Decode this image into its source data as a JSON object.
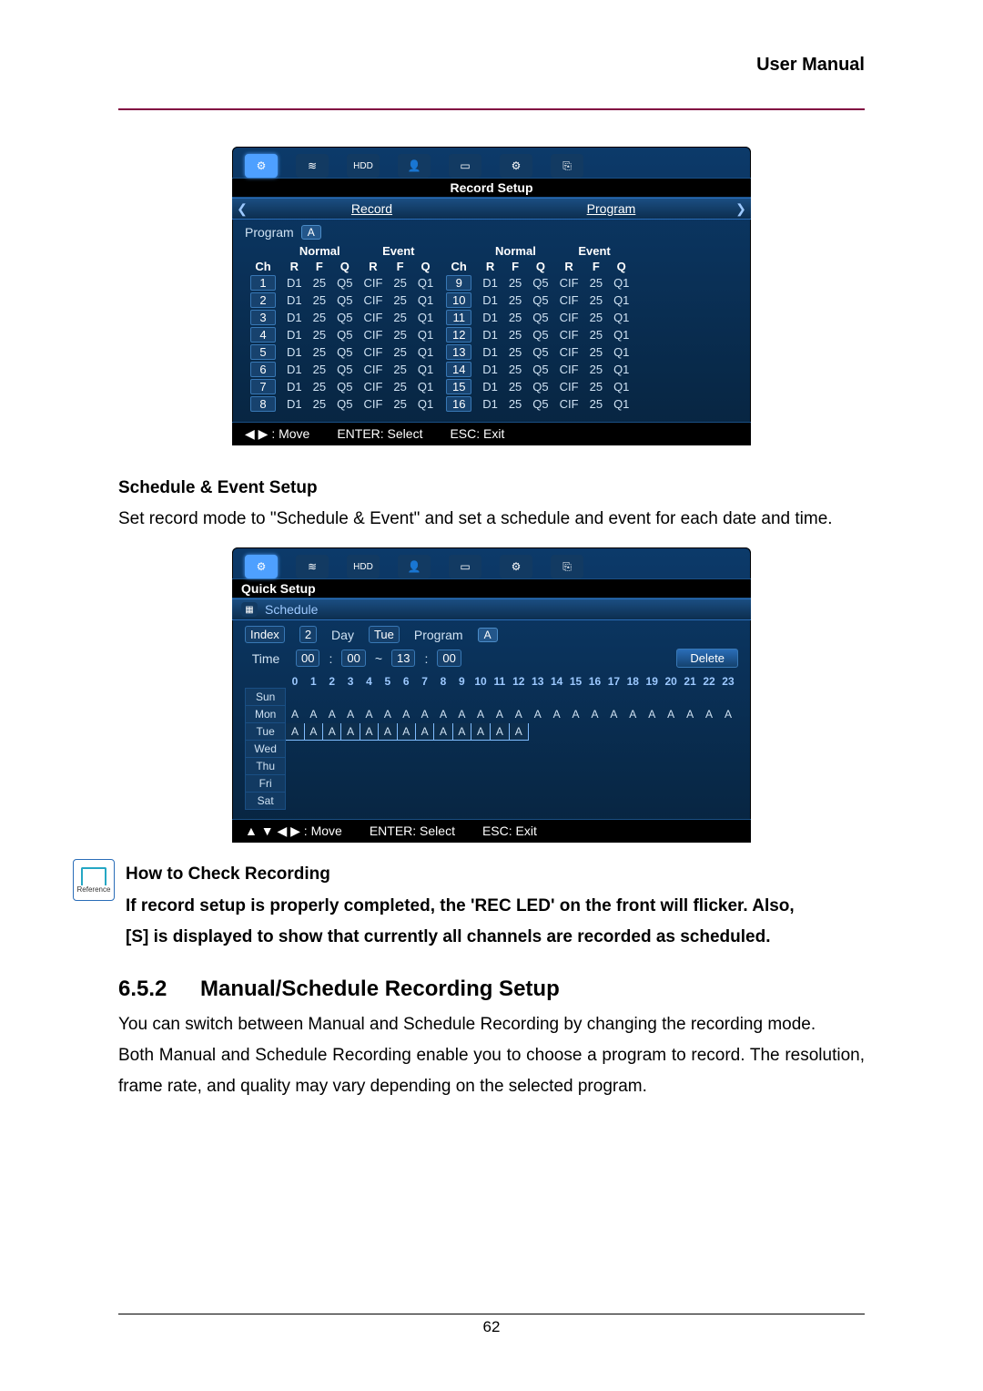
{
  "header": {
    "title": "User Manual"
  },
  "record_panel": {
    "title": "Record Setup",
    "icons": [
      "gear",
      "wifi",
      "hdd",
      "user",
      "display",
      "settings",
      "exit"
    ],
    "tabs": {
      "left": "Record",
      "right": "Program"
    },
    "program_label": "Program",
    "program_badge": "A",
    "group_headers": [
      "Normal",
      "Event",
      "Normal",
      "Event"
    ],
    "col_headers": [
      "Ch",
      "R",
      "F",
      "Q",
      "R",
      "F",
      "Q",
      "Ch",
      "R",
      "F",
      "Q",
      "R",
      "F",
      "Q"
    ],
    "rows_left": [
      {
        "ch": "1",
        "r1": "D1",
        "f1": "25",
        "q1": "Q5",
        "r2": "CIF",
        "f2": "25",
        "q2": "Q1"
      },
      {
        "ch": "2",
        "r1": "D1",
        "f1": "25",
        "q1": "Q5",
        "r2": "CIF",
        "f2": "25",
        "q2": "Q1"
      },
      {
        "ch": "3",
        "r1": "D1",
        "f1": "25",
        "q1": "Q5",
        "r2": "CIF",
        "f2": "25",
        "q2": "Q1"
      },
      {
        "ch": "4",
        "r1": "D1",
        "f1": "25",
        "q1": "Q5",
        "r2": "CIF",
        "f2": "25",
        "q2": "Q1"
      },
      {
        "ch": "5",
        "r1": "D1",
        "f1": "25",
        "q1": "Q5",
        "r2": "CIF",
        "f2": "25",
        "q2": "Q1"
      },
      {
        "ch": "6",
        "r1": "D1",
        "f1": "25",
        "q1": "Q5",
        "r2": "CIF",
        "f2": "25",
        "q2": "Q1"
      },
      {
        "ch": "7",
        "r1": "D1",
        "f1": "25",
        "q1": "Q5",
        "r2": "CIF",
        "f2": "25",
        "q2": "Q1"
      },
      {
        "ch": "8",
        "r1": "D1",
        "f1": "25",
        "q1": "Q5",
        "r2": "CIF",
        "f2": "25",
        "q2": "Q1"
      }
    ],
    "rows_right": [
      {
        "ch": "9",
        "r1": "D1",
        "f1": "25",
        "q1": "Q5",
        "r2": "CIF",
        "f2": "25",
        "q2": "Q1"
      },
      {
        "ch": "10",
        "r1": "D1",
        "f1": "25",
        "q1": "Q5",
        "r2": "CIF",
        "f2": "25",
        "q2": "Q1"
      },
      {
        "ch": "11",
        "r1": "D1",
        "f1": "25",
        "q1": "Q5",
        "r2": "CIF",
        "f2": "25",
        "q2": "Q1"
      },
      {
        "ch": "12",
        "r1": "D1",
        "f1": "25",
        "q1": "Q5",
        "r2": "CIF",
        "f2": "25",
        "q2": "Q1"
      },
      {
        "ch": "13",
        "r1": "D1",
        "f1": "25",
        "q1": "Q5",
        "r2": "CIF",
        "f2": "25",
        "q2": "Q1"
      },
      {
        "ch": "14",
        "r1": "D1",
        "f1": "25",
        "q1": "Q5",
        "r2": "CIF",
        "f2": "25",
        "q2": "Q1"
      },
      {
        "ch": "15",
        "r1": "D1",
        "f1": "25",
        "q1": "Q5",
        "r2": "CIF",
        "f2": "25",
        "q2": "Q1"
      },
      {
        "ch": "16",
        "r1": "D1",
        "f1": "25",
        "q1": "Q5",
        "r2": "CIF",
        "f2": "25",
        "q2": "Q1"
      }
    ],
    "footer": {
      "move": "◀ ▶ : Move",
      "enter": "ENTER: Select",
      "esc": "ESC: Exit"
    }
  },
  "schedule_section": {
    "heading": "Schedule & Event Setup",
    "body": "Set record mode to \"Schedule & Event\" and set a schedule and event for each date and time."
  },
  "schedule_panel": {
    "title": "Quick Setup",
    "tab": "Schedule",
    "icons": [
      "gear",
      "wifi",
      "hdd",
      "user",
      "display",
      "settings",
      "exit"
    ],
    "fields": {
      "index_label": "Index",
      "index_value": "2",
      "day_label": "Day",
      "day_value": "Tue",
      "program_label": "Program",
      "program_value": "A",
      "time_label": "Time",
      "t1": "00",
      "t2": "00",
      "dash": "~",
      "t3": "13",
      "t4": "00",
      "delete_label": "Delete"
    },
    "hours": [
      "0",
      "1",
      "2",
      "3",
      "4",
      "5",
      "6",
      "7",
      "8",
      "9",
      "10",
      "11",
      "12",
      "13",
      "14",
      "15",
      "16",
      "17",
      "18",
      "19",
      "20",
      "21",
      "22",
      "23"
    ],
    "days": [
      "Sun",
      "Mon",
      "Tue",
      "Wed",
      "Thu",
      "Fri",
      "Sat"
    ],
    "mon_row": [
      "A",
      "A",
      "A",
      "A",
      "A",
      "A",
      "A",
      "A",
      "A",
      "A",
      "A",
      "A",
      "A",
      "A",
      "A",
      "A",
      "A",
      "A",
      "A",
      "A",
      "A",
      "A",
      "A",
      "A"
    ],
    "tue_row": [
      "A",
      "A",
      "A",
      "A",
      "A",
      "A",
      "A",
      "A",
      "A",
      "A",
      "A",
      "A",
      "A"
    ],
    "footer": {
      "move": "▲ ▼ ◀ ▶ : Move",
      "enter": "ENTER: Select",
      "esc": "ESC: Exit"
    }
  },
  "reference": {
    "caption": "Reference",
    "title": "How to Check Recording",
    "line1": "If record setup is properly completed, the 'REC LED' on the front will flicker. Also,",
    "line2": "[S] is displayed to show that currently all channels are recorded as scheduled."
  },
  "section_heading": {
    "num": "6.5.2",
    "title": "Manual/Schedule Recording Setup"
  },
  "para1": "You can switch between Manual and Schedule Recording by changing the recording mode.",
  "para2": "Both Manual and Schedule Recording enable you to choose a program to record. The resolution, frame rate, and quality may vary depending on the selected program.",
  "page_number": "62"
}
